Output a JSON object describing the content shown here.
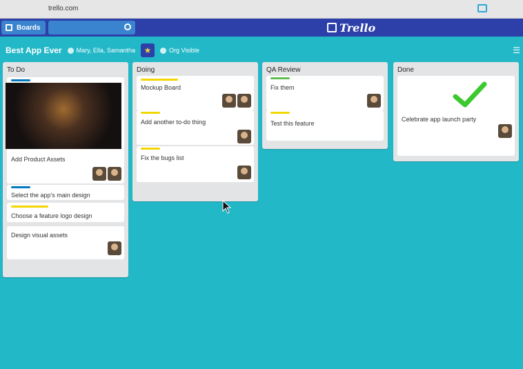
{
  "browser": {
    "url": "trello.com"
  },
  "header": {
    "boards_label": "Boards",
    "logo_text": "Trello"
  },
  "board": {
    "title": "Best App Ever",
    "team_label": "Mary, Ella, Samantha",
    "visibility_label": "Org Visible"
  },
  "lists": [
    {
      "title": "To Do",
      "cards": [
        {
          "text": "Add Product Assets"
        },
        {
          "text": "Select the app's main design"
        },
        {
          "text": "Choose a feature logo design"
        },
        {
          "text": "Design visual assets"
        }
      ]
    },
    {
      "title": "Doing",
      "cards": [
        {
          "text": "Mockup Board"
        },
        {
          "text": "Add another to-do thing"
        },
        {
          "text": "Fix the bugs list"
        }
      ]
    },
    {
      "title": "QA Review",
      "cards": [
        {
          "text": "Fix them"
        },
        {
          "text": "Test this feature"
        }
      ]
    },
    {
      "title": "Done",
      "cards": [
        {
          "text": "Celebrate app launch party"
        }
      ]
    }
  ],
  "colors": {
    "background": "#22b8c8",
    "header": "#2d3fa8",
    "label_green": "#61bd4f",
    "label_yellow": "#f2d600",
    "label_blue": "#0079bf",
    "check": "#3cc92f"
  },
  "icons": [
    "boards-icon",
    "search-icon",
    "trello-logo-icon",
    "star-icon",
    "checkmark-icon",
    "menu-icon"
  ]
}
